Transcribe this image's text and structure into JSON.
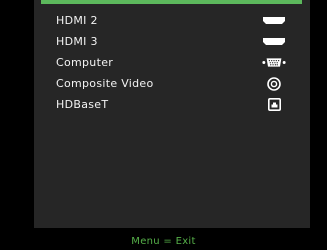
{
  "menu": {
    "accent_color": "#5cb85c",
    "items": [
      {
        "label": "HDMI 2",
        "icon": "hdmi-port-icon"
      },
      {
        "label": "HDMI 3",
        "icon": "hdmi-port-icon"
      },
      {
        "label": "Computer",
        "icon": "vga-port-icon"
      },
      {
        "label": "Composite Video",
        "icon": "rca-jack-icon"
      },
      {
        "label": "HDBaseT",
        "icon": "rj45-port-icon"
      }
    ]
  },
  "footer": {
    "hint": "Menu = Exit",
    "color": "#56b049"
  }
}
